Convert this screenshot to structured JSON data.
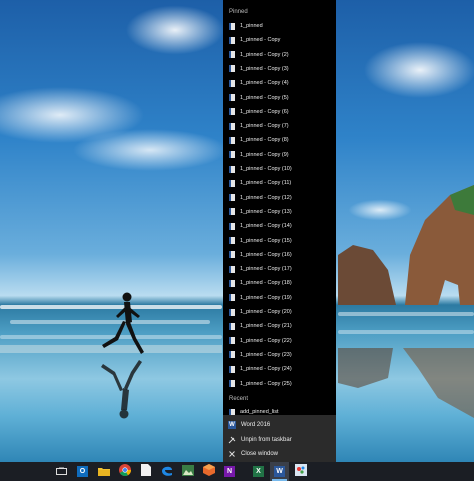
{
  "jumplist": {
    "pinned_header": "Pinned",
    "pinned_items": [
      "1_pinned",
      "1_pinned - Copy",
      "1_pinned - Copy (2)",
      "1_pinned - Copy (3)",
      "1_pinned - Copy (4)",
      "1_pinned - Copy (5)",
      "1_pinned - Copy (6)",
      "1_pinned - Copy (7)",
      "1_pinned - Copy (8)",
      "1_pinned - Copy (9)",
      "1_pinned - Copy (10)",
      "1_pinned - Copy (11)",
      "1_pinned - Copy (12)",
      "1_pinned - Copy (13)",
      "1_pinned - Copy (14)",
      "1_pinned - Copy (15)",
      "1_pinned - Copy (16)",
      "1_pinned - Copy (17)",
      "1_pinned - Copy (18)",
      "1_pinned - Copy (19)",
      "1_pinned - Copy (20)",
      "1_pinned - Copy (21)",
      "1_pinned - Copy (22)",
      "1_pinned - Copy (23)",
      "1_pinned - Copy (24)",
      "1_pinned - Copy (25)"
    ],
    "recent_header": "Recent",
    "recent_items": [
      "add_pinned_list"
    ],
    "app_name": "Word 2016",
    "unpin_label": "Unpin from taskbar",
    "close_label": "Close window"
  },
  "taskbar": {
    "apps": [
      {
        "icon": "task-view-icon",
        "active": false
      },
      {
        "icon": "outlook-icon",
        "active": false
      },
      {
        "icon": "file-explorer-icon",
        "active": false
      },
      {
        "icon": "chrome-icon",
        "active": false
      },
      {
        "icon": "blank-document-icon",
        "active": false
      },
      {
        "icon": "edge-icon",
        "active": false
      },
      {
        "icon": "photos-icon",
        "active": false
      },
      {
        "icon": "app-cube-icon",
        "active": false
      },
      {
        "icon": "onenote-icon",
        "active": false
      },
      {
        "icon": "excel-icon",
        "active": false
      },
      {
        "icon": "word-icon",
        "active": true
      },
      {
        "icon": "paint-icon",
        "active": false
      }
    ],
    "word_letter": "W",
    "excel_letter": "X",
    "onenote_letter": "N",
    "outlook_letter": "O"
  },
  "colors": {
    "jumplist_bg": "#000000",
    "app_section_bg": "#2b2b2b",
    "taskbar_bg": "#1b1e24",
    "active_indicator": "#76b9ed",
    "word_blue": "#2b579a"
  }
}
